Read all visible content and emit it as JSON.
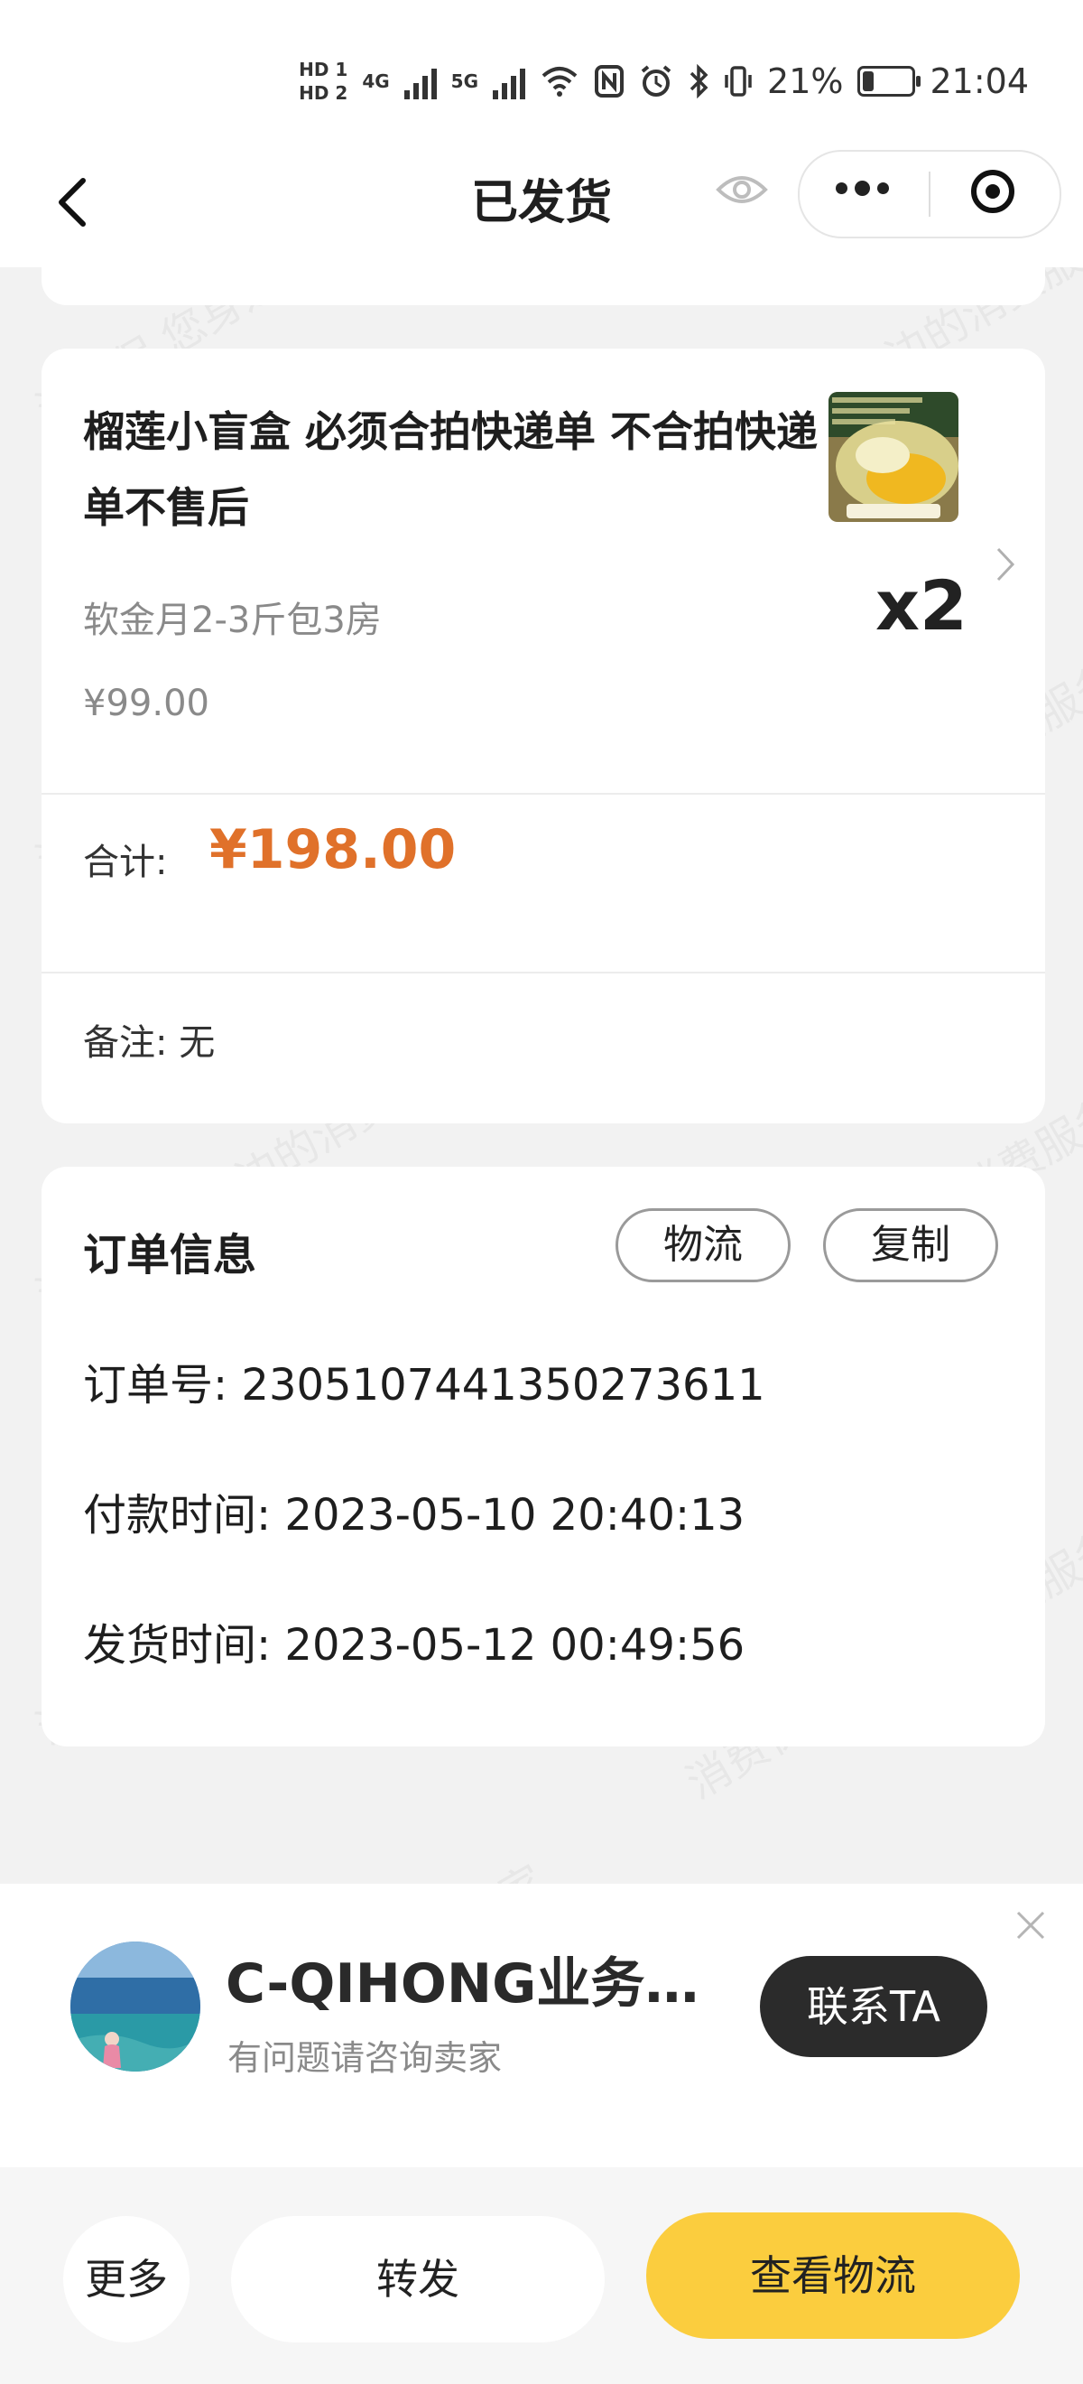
{
  "status_bar": {
    "sim1": "HD 1",
    "sim2": "HD 2",
    "net1": "4G",
    "net2": "5G",
    "battery": "21%",
    "time": "21:04"
  },
  "nav": {
    "title": "已发货"
  },
  "product": {
    "title": "榴莲小盲盒 必须合拍快递单 不合拍快递单不售后",
    "spec": "软金月2-3斤包3房",
    "price": "¥99.00",
    "quantity": "x2"
  },
  "summary": {
    "total_label": "合计:",
    "total_value": "¥198.00",
    "note": "备注:  无"
  },
  "order_info": {
    "title": "订单信息",
    "logistics_button": "物流",
    "copy_button": "复制",
    "order_no": "订单号:  2305107441350273611",
    "paid_time": "付款时间:  2023-05-10 20:40:13",
    "shipped_time": "发货时间:  2023-05-12 00:49:56"
  },
  "seller": {
    "name": "C-QIHONG业务员晓晓",
    "subtitle": "有问题请咨询卖家",
    "contact_button": "联系TA"
  },
  "bottom_bar": {
    "more": "更多",
    "forward": "转发",
    "track": "查看物流"
  },
  "watermark": "消费保 您身边的消费服务管家",
  "colors": {
    "accent_orange": "#e0712a",
    "primary_yellow": "#fbcd3e",
    "dark_button": "#2b2b2b"
  }
}
